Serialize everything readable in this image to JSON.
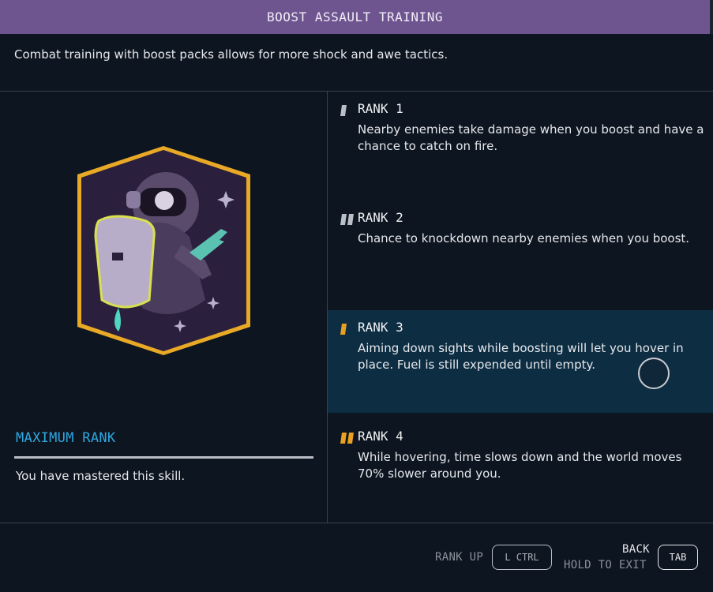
{
  "header": {
    "title": "BOOST ASSAULT TRAINING"
  },
  "description": "Combat training with boost packs allows for more shock and awe tactics.",
  "left_panel": {
    "max_rank_label": "MAXIMUM RANK",
    "mastered_text": "You have mastered this skill.",
    "patch_icon": "astronaut-boost-pack-patch"
  },
  "ranks": [
    {
      "title": "RANK 1",
      "desc": "Nearby enemies take damage when you boost and have a chance to catch on fire."
    },
    {
      "title": "RANK 2",
      "desc": "Chance to knockdown nearby enemies when you boost."
    },
    {
      "title": "RANK 3",
      "desc": "Aiming down sights while boosting will let you hover in place. Fuel is still expended until empty."
    },
    {
      "title": "RANK 4",
      "desc": "While hovering, time slows down and the world moves 70% slower around you."
    }
  ],
  "footer": {
    "rank_up_label": "RANK UP",
    "rank_up_key": "L CTRL",
    "back_label": "BACK",
    "hold_exit_label": "HOLD TO EXIT",
    "back_key": "TAB"
  },
  "colors": {
    "header_bg": "#6f5590",
    "accent_blue": "#2ea7e0",
    "rank_active": "#0d2d42",
    "rank_orange": "#e9a020",
    "rank_gray": "#b9bec6"
  }
}
